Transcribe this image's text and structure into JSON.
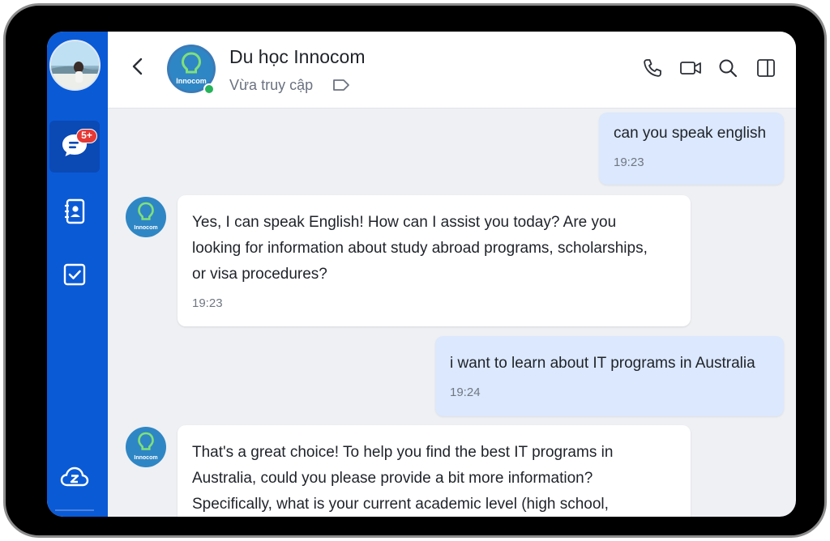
{
  "sidebar": {
    "unread_badge": "5+",
    "items": [
      {
        "name": "messages",
        "icon": "chat-bubble-icon",
        "active": true
      },
      {
        "name": "contacts",
        "icon": "contact-book-icon",
        "active": false
      },
      {
        "name": "todo",
        "icon": "checkbox-icon",
        "active": false
      },
      {
        "name": "cloud",
        "icon": "zalo-cloud-icon",
        "active": false
      }
    ]
  },
  "header": {
    "contact_name": "Du học Innocom",
    "status": "Vừa truy cập",
    "avatar_text": "Innocom",
    "icons": [
      "back-arrow-icon",
      "tag-icon",
      "phone-icon",
      "video-call-icon",
      "search-icon",
      "panel-toggle-icon"
    ]
  },
  "messages": [
    {
      "direction": "out",
      "text": "can you speak english",
      "time": "19:23"
    },
    {
      "direction": "in",
      "text": "Yes, I can speak English! How can I assist you today? Are you\nlooking for information about study abroad programs, scholarships,\nor visa procedures?",
      "time": "19:23"
    },
    {
      "direction": "out",
      "text": "i want to learn about IT programs in Australia",
      "time": "19:24"
    },
    {
      "direction": "in",
      "text": "That's a great choice! To help you find the best IT programs in\nAustralia, could you please provide a bit more information?\nSpecifically, what is your current academic level (high school,",
      "time": ""
    }
  ],
  "colors": {
    "nav_blue": "#0a5ad6",
    "outgoing_bubble": "#dbe8fd",
    "incoming_bubble": "#ffffff",
    "online": "#27b35a",
    "badge": "#e53935"
  }
}
